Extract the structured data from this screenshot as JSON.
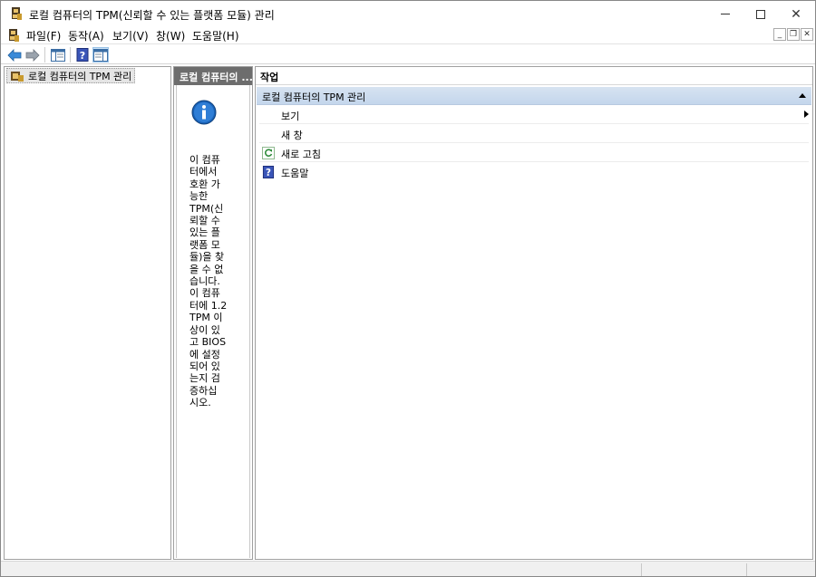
{
  "window": {
    "title": "로컬 컴퓨터의 TPM(신뢰할 수 있는 플랫폼 모듈) 관리",
    "icon": "tpm-snapin-icon",
    "controls": {
      "minimize": "minimize-icon",
      "maximize": "maximize-icon",
      "close": "✕"
    }
  },
  "menubar": {
    "items": [
      {
        "label": "파일(F)"
      },
      {
        "label": "동작(A)"
      },
      {
        "label": "보기(V)"
      },
      {
        "label": "창(W)"
      },
      {
        "label": "도움말(H)"
      }
    ],
    "mdi_controls": {
      "minimize": "_",
      "restore": "❐",
      "close": "✕"
    }
  },
  "toolbar": {
    "buttons": [
      {
        "icon": "back-arrow-icon"
      },
      {
        "icon": "forward-arrow-icon"
      },
      {
        "icon": "show-hide-console-tree-icon"
      },
      {
        "icon": "help-icon"
      },
      {
        "icon": "show-hide-action-pane-icon"
      }
    ]
  },
  "tree": {
    "root_label": "로컬 컴퓨터의 TPM 관리"
  },
  "center": {
    "header": "로컬 컴퓨터의 ...",
    "message": "이 컴퓨터에서 호환 가능한 TPM(신뢰할 수 있는 플랫폼 모듈)을 찾을 수 없습니다. 이 컴퓨터에 1.2 TPM 이상이 있고 BIOS에 설정되어 있는지 검증하십시오.",
    "message_lines": [
      "이 컴퓨",
      "터에서",
      "호환 가",
      "능한",
      "TPM(신",
      "뢰할 수",
      "있는 플",
      "랫폼 모",
      "듈)을 찾",
      "을 수 없",
      "습니다.",
      "이 컴퓨",
      "터에 1.2",
      "TPM 이",
      "상이 있",
      "고 BIOS",
      "에 설정",
      "되어 있",
      "는지 검",
      "증하십",
      "시오."
    ]
  },
  "actions": {
    "header": "작업",
    "section_title": "로컬 컴퓨터의 TPM 관리",
    "items": [
      {
        "label": "보기",
        "icon": "",
        "has_submenu": true
      },
      {
        "label": "새 창",
        "icon": ""
      },
      {
        "label": "새로 고침",
        "icon": "refresh-icon"
      },
      {
        "label": "도움말",
        "icon": "help-icon"
      }
    ]
  },
  "colors": {
    "section_header": "#c4d6ec",
    "center_header": "#6d6d6d"
  }
}
